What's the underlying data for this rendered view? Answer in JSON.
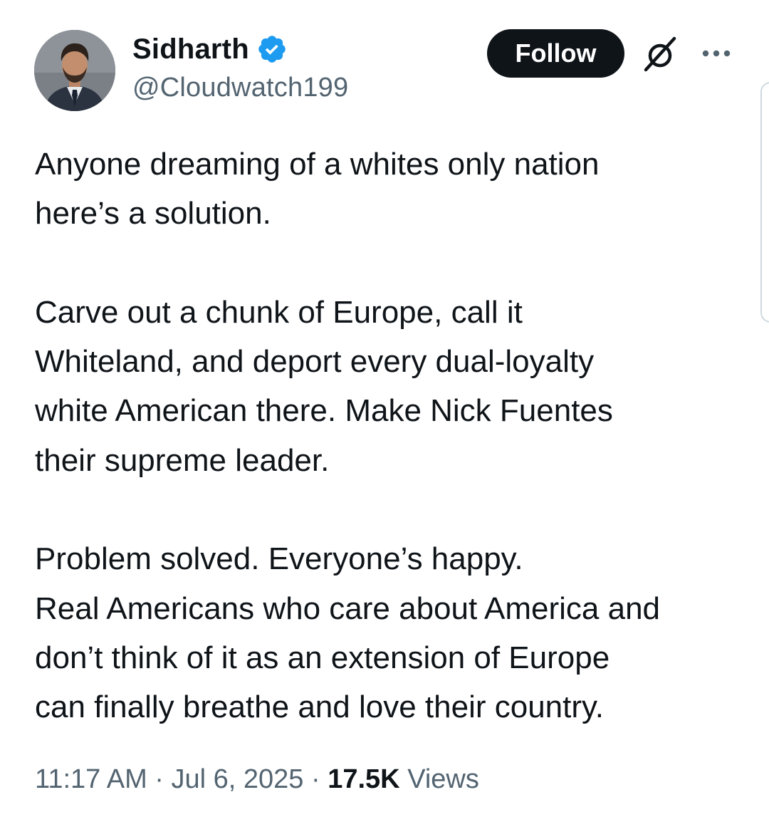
{
  "author": {
    "display_name": "Sidharth",
    "handle": "@Cloudwatch199",
    "verified": true,
    "avatar_icon": "profile-photo"
  },
  "actions": {
    "follow_label": "Follow",
    "grok_icon": "grok-icon",
    "more_icon": "more-options-icon"
  },
  "tweet": {
    "lines": [
      "Anyone dreaming of a whites only nation",
      "here’s a solution.",
      "",
      "Carve out a chunk of Europe, call it",
      "Whiteland, and deport every dual-loyalty",
      "white American there. Make Nick Fuentes",
      "their supreme leader.",
      "",
      "Problem solved. Everyone’s happy.",
      "Real Americans who care about America and",
      "don’t think of it as an extension of Europe",
      "can finally breathe and love their country."
    ]
  },
  "meta": {
    "time": "11:17 AM",
    "separator": " · ",
    "date": "Jul 6, 2025",
    "views_count": "17.5K",
    "views_label": "Views"
  },
  "colors": {
    "text_primary": "#0f1419",
    "text_secondary": "#536471",
    "verified_blue": "#1d9bf0",
    "button_bg": "#0f1419",
    "button_text": "#ffffff"
  }
}
